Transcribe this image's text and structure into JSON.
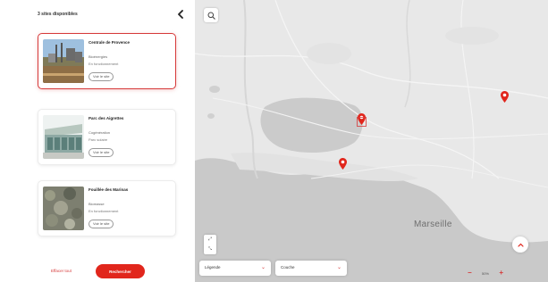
{
  "sidebar": {
    "title": "3 sites disponibles",
    "collapse_icon": "chevron-left-icon",
    "sites": [
      {
        "name": "Centrale de Provence",
        "type": "Bioénergies",
        "status": "En fonctionnement",
        "button": "Voir le site"
      },
      {
        "name": "Parc des Aigrettes",
        "type": "Cogénération",
        "status": "Parc solaire",
        "button": "Voir le site"
      },
      {
        "name": "Fouillée des Marinas",
        "type": "Biomasse",
        "status": "En fonctionnement",
        "button": "Voir le site"
      }
    ],
    "clear_label": "Effacer tout",
    "search_label": "Rechercher"
  },
  "map": {
    "city_label": "Marseille",
    "legend_dropdown": "Légende",
    "layer_dropdown": "Couche",
    "zoom_value": "50%",
    "search_icon": "search-icon",
    "expand_icon": "expand-icon"
  },
  "colors": {
    "accent": "#e1261c",
    "selected_border": "#d63a3a",
    "land": "#e8e8e8",
    "water": "#c9c9c9",
    "pin": "#e1261c"
  }
}
